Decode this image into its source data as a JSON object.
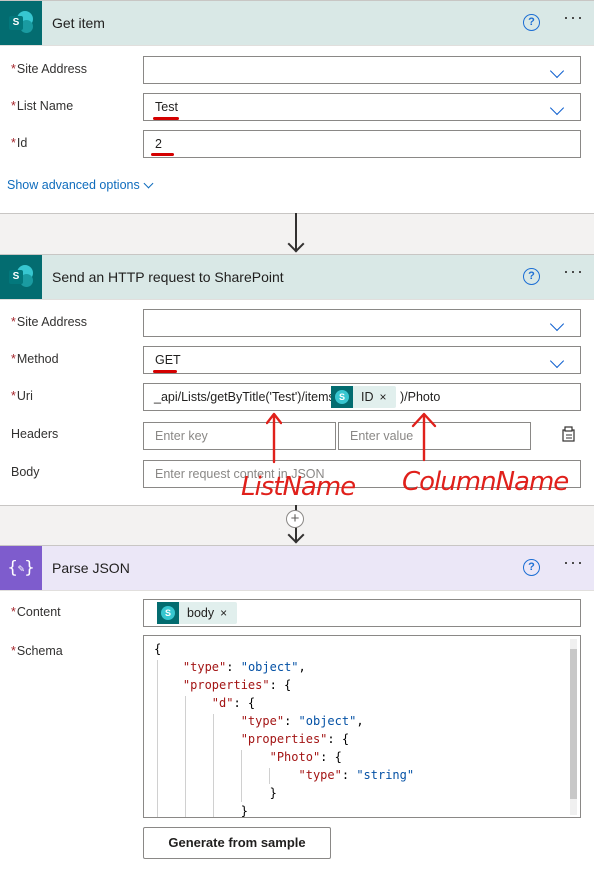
{
  "get_item": {
    "title": "Get item",
    "help_label": "?",
    "more_label": "···",
    "fields": {
      "site_address": {
        "label": "Site Address",
        "value": ""
      },
      "list_name": {
        "label": "List Name",
        "value": "Test"
      },
      "id": {
        "label": "Id",
        "value": "2"
      }
    },
    "advanced_link": "Show advanced options"
  },
  "http_request": {
    "title": "Send an HTTP request to SharePoint",
    "help_label": "?",
    "more_label": "···",
    "fields": {
      "site_address": {
        "label": "Site Address",
        "value": ""
      },
      "method": {
        "label": "Method",
        "value": "GET"
      },
      "uri": {
        "label": "Uri",
        "prefix": "_api/Lists/getByTitle('Test')/items(",
        "token": "ID",
        "suffix": ")/Photo"
      },
      "headers": {
        "label": "Headers",
        "key_placeholder": "Enter key",
        "value_placeholder": "Enter value"
      },
      "body": {
        "label": "Body",
        "placeholder": "Enter request content in JSON"
      }
    }
  },
  "parse_json": {
    "title": "Parse JSON",
    "help_label": "?",
    "more_label": "···",
    "fields": {
      "content": {
        "label": "Content",
        "token": "body"
      },
      "schema": {
        "label": "Schema"
      }
    },
    "schema_lines": [
      "{",
      "    \"type\": \"object\",",
      "    \"properties\": {",
      "        \"d\": {",
      "            \"type\": \"object\",",
      "            \"properties\": {",
      "                \"Photo\": {",
      "                    \"type\": \"string\"",
      "                }",
      "            }"
    ],
    "generate_button": "Generate from sample"
  },
  "annotations": {
    "list_name": "ListName",
    "column_name": "ColumnName"
  },
  "required_mark": "*",
  "token_close": "×",
  "sp_letter": "S",
  "colors": {
    "sharepoint_header": "#d9e8e6",
    "sharepoint_icon": "#036c70",
    "parse_json_icon": "#7e5ccd",
    "annotation_red": "#e0201b",
    "link_blue": "#0f6cbd"
  }
}
